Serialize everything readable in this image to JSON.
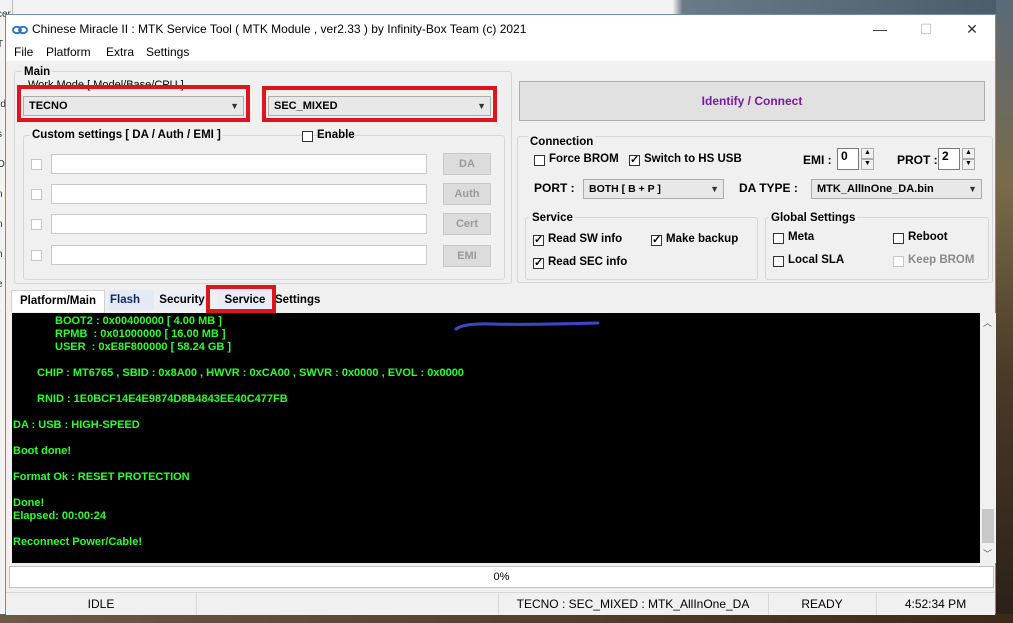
{
  "window": {
    "title": "Chinese Miracle II : MTK Service Tool ( MTK Module , ver2.33 ) by Infinity-Box Team (c) 2021",
    "controls": {
      "minimize": "—",
      "maximize": "☐",
      "close": "✕"
    }
  },
  "menu": {
    "file": "File",
    "platform": "Platform",
    "extra": "Extra",
    "settings": "Settings"
  },
  "main": {
    "legend": "Main",
    "workmode_label": "Work Mode [ Model/Base/CPU ]",
    "brand_select": "TECNO",
    "platform_select": "SEC_MIXED",
    "custom_settings_label": "Custom settings [ DA / Auth / EMI ]",
    "enable_label": "Enable",
    "buttons": {
      "da": "DA",
      "auth": "Auth",
      "cert": "Cert",
      "emi": "EMI"
    }
  },
  "identify_button": "Identify / Connect",
  "connection": {
    "legend": "Connection",
    "force_brom": "Force BROM",
    "switch_hs_usb": "Switch to HS USB",
    "emi_label": "EMI :",
    "emi_value": "0",
    "prot_label": "PROT :",
    "prot_value": "2",
    "port_label": "PORT :",
    "port_value": "BOTH [ B + P ]",
    "da_type_label": "DA TYPE :",
    "da_type_value": "MTK_AllInOne_DA.bin"
  },
  "service": {
    "legend": "Service",
    "read_sw_info": "Read SW info",
    "make_backup": "Make backup",
    "read_sec_info": "Read SEC info"
  },
  "global_settings": {
    "legend": "Global Settings",
    "meta": "Meta",
    "reboot": "Reboot",
    "local_sla": "Local SLA",
    "keep_brom": "Keep BROM"
  },
  "tabs": {
    "platform_main": "Platform/Main",
    "flash": "Flash",
    "security": "Security",
    "service": "Service",
    "settings": "Settings"
  },
  "console": [
    "BOOT2 : 0x00400000 [ 4.00 MB ]",
    "RPMB  : 0x01000000 [ 16.00 MB ]",
    "USER  : 0xE8F800000 [ 58.24 GB ]",
    "CHIP : MT6765 , SBID : 0x8A00 , HWVR : 0xCA00 , SWVR : 0x0000 , EVOL : 0x0000",
    "RNID : 1E0BCF14E4E9874D8B4843EE40C477FB",
    "DA : USB : HIGH-SPEED",
    "Boot done!",
    "Format Ok : RESET PROTECTION",
    "Done!",
    "Elapsed: 00:00:24",
    "Reconnect Power/Cable!"
  ],
  "progress": "0%",
  "status": {
    "state": "IDLE",
    "info": "TECNO : SEC_MIXED : MTK_AllInOne_DA",
    "ready": "READY",
    "time": "4:52:34 PM"
  },
  "desktop_left_text": [
    "cer",
    "T",
    "/",
    "rd",
    "s",
    "O",
    "n",
    "n",
    "h",
    "e",
    "r"
  ],
  "colors": {
    "console_bg": "#000000",
    "console_text": "#2dff2d",
    "highlight": "#e0141e",
    "identify_text": "#7a1aa0"
  }
}
